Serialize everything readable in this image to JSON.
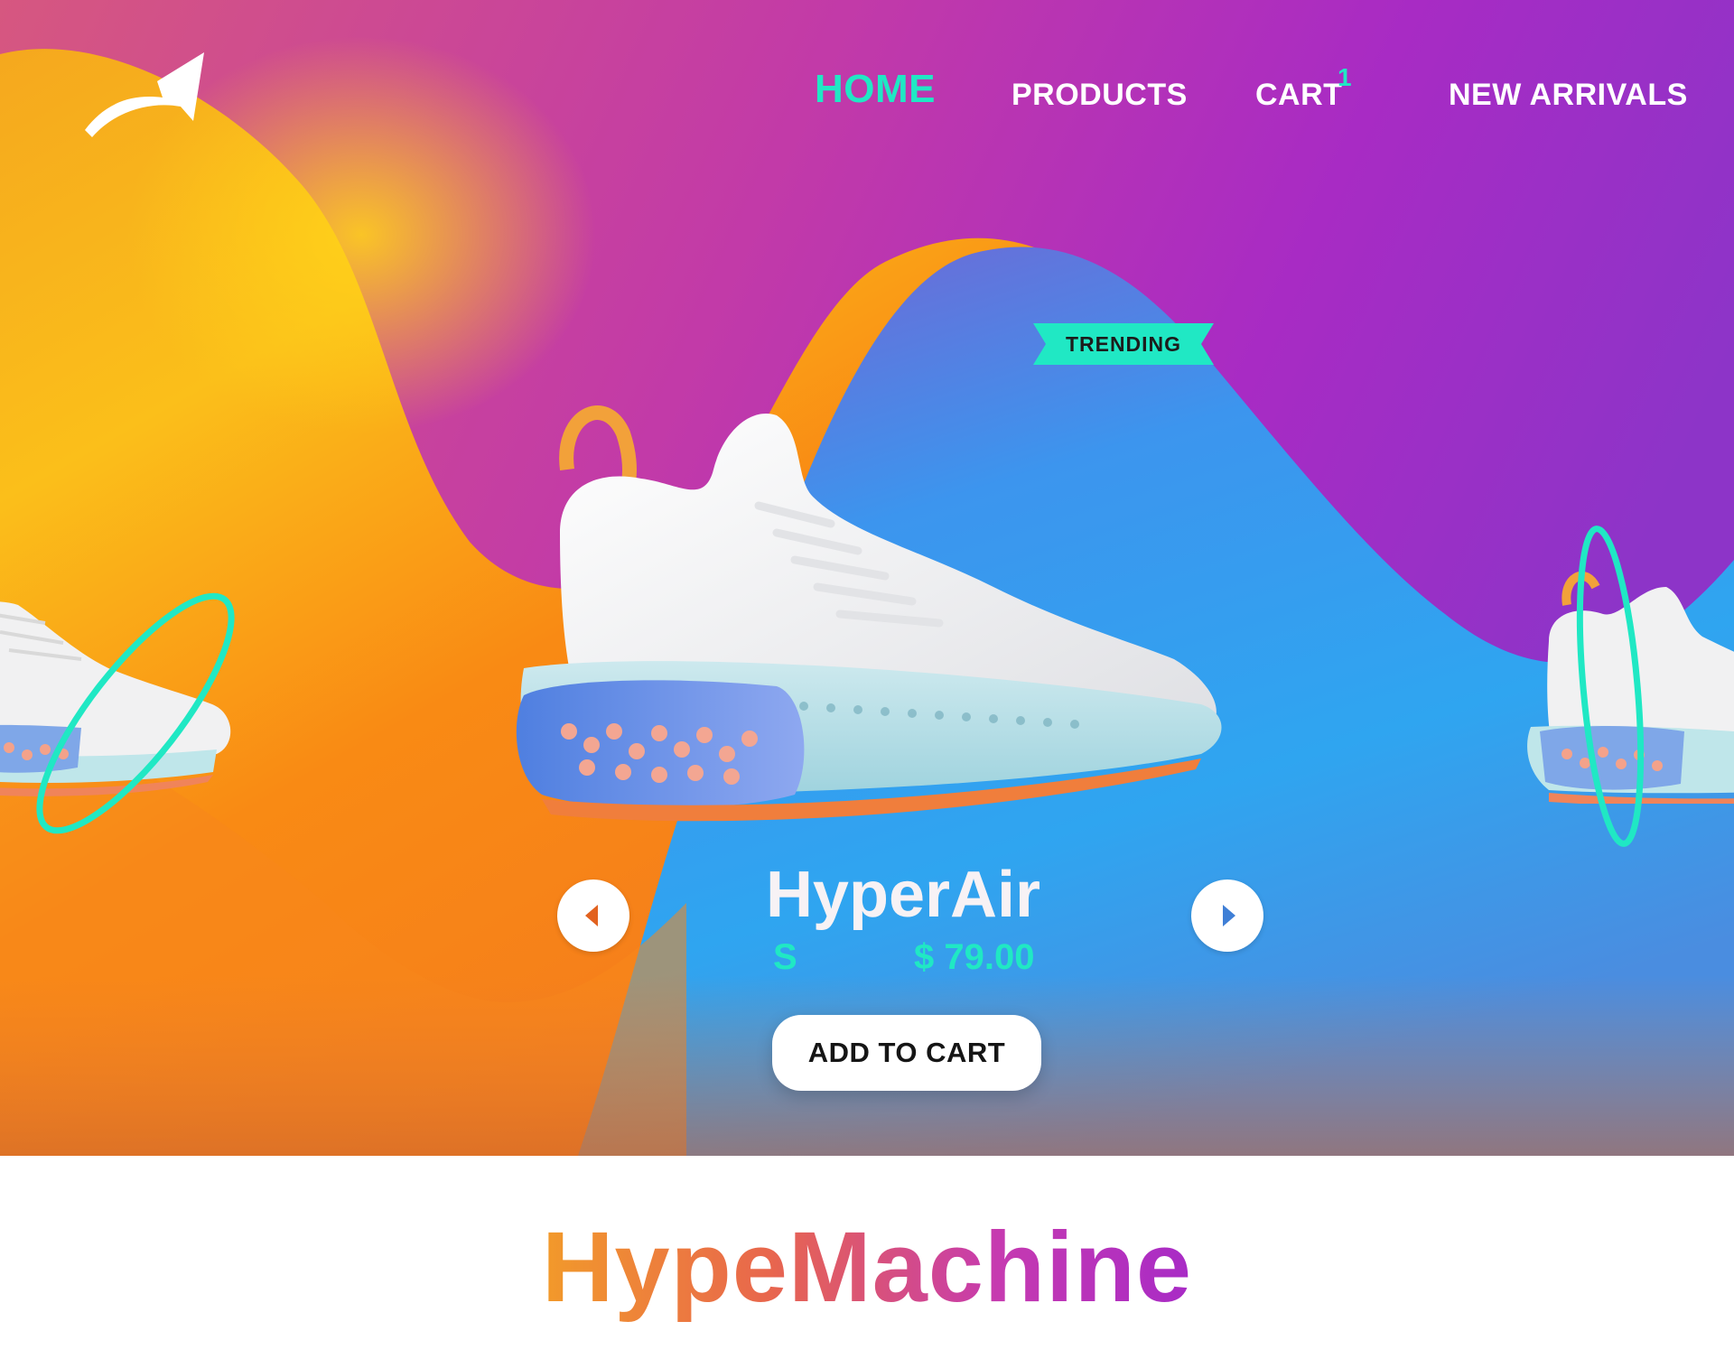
{
  "logo": {
    "icon": "curved-arrow-icon"
  },
  "nav": {
    "items": [
      {
        "label": "HOME",
        "active": true
      },
      {
        "label": "PRODUCTS",
        "active": false
      },
      {
        "label": "CART",
        "active": false
      },
      {
        "label": "NEW ARRIVALS",
        "active": false
      }
    ],
    "cart_count": "1"
  },
  "hero": {
    "badge": "TRENDING",
    "product_name": "HyperAir",
    "size": "S",
    "price": "$ 79.00",
    "add_to_cart_label": "ADD TO CART",
    "prev_icon": "triangle-left-icon",
    "next_icon": "triangle-right-icon"
  },
  "brand": {
    "name": "HypeMachine"
  },
  "colors": {
    "accent": "#20e8c4",
    "orange": "#f7931e",
    "yellow": "#fbc41c",
    "purple": "#a92bc4",
    "blue": "#2f9df2"
  }
}
